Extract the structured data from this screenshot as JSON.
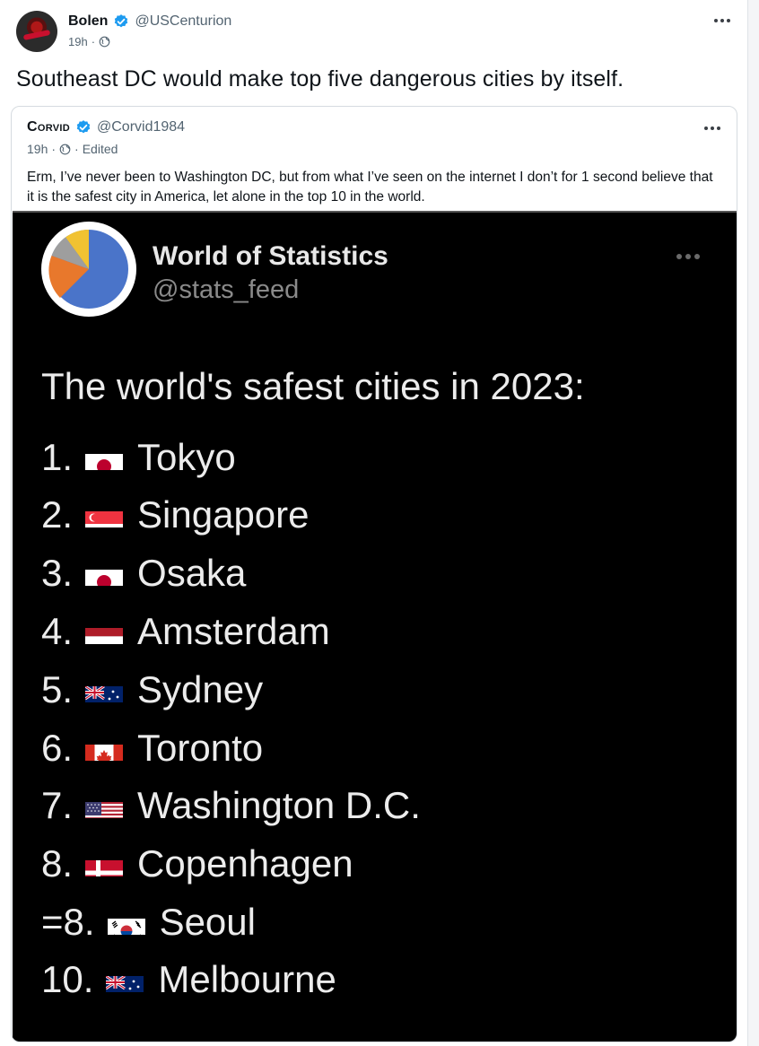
{
  "post": {
    "author_name": "Bolen",
    "handle": "@USCenturion",
    "time": "19h",
    "separator": "·",
    "text": "Southeast DC would make top five dangerous cities by itself."
  },
  "quote": {
    "author_name": "Corvid",
    "handle": "@Corvid1984",
    "time": "19h",
    "separator": "·",
    "edited_separator": "·",
    "edited": "Edited",
    "text": "Erm, I’ve never been to Washington DC, but from what I’ve seen on the internet I don’t for 1 second believe that it is the safest city in America, let alone in the top 10 in the world."
  },
  "image": {
    "account_name": "World of Statistics",
    "account_handle": "@stats_feed",
    "heading": "The world's safest cities in 2023:",
    "ranks": [
      {
        "rank": "1.",
        "city": "Tokyo",
        "flag": "jp"
      },
      {
        "rank": "2.",
        "city": "Singapore",
        "flag": "sg"
      },
      {
        "rank": "3.",
        "city": "Osaka",
        "flag": "jp"
      },
      {
        "rank": "4.",
        "city": "Amsterdam",
        "flag": "nl"
      },
      {
        "rank": "5.",
        "city": "Sydney",
        "flag": "au"
      },
      {
        "rank": "6.",
        "city": "Toronto",
        "flag": "ca"
      },
      {
        "rank": "7.",
        "city": "Washington D.C.",
        "flag": "us"
      },
      {
        "rank": "8.",
        "city": "Copenhagen",
        "flag": "dk"
      },
      {
        "rank": "=8.",
        "city": "Seoul",
        "flag": "kr"
      },
      {
        "rank": "10.",
        "city": "Melbourne",
        "flag": "au"
      }
    ]
  },
  "icons": {
    "verified": "verified-badge-icon",
    "globe": "globe-icon",
    "more": "more-options-icon"
  },
  "colors": {
    "verified_blue": "#1d9bf0",
    "secondary_text": "#536471",
    "image_bg": "#000000"
  }
}
